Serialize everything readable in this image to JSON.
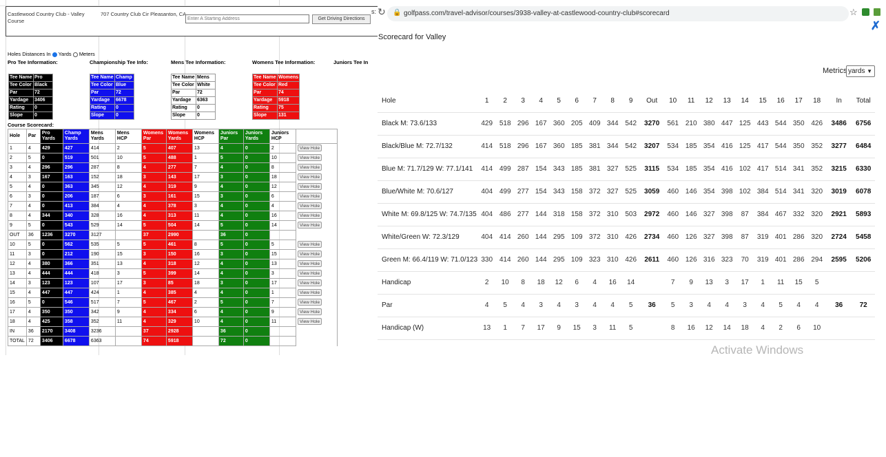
{
  "left": {
    "course_name": "Castlewood Country Club - Valley Course",
    "course_address": "707 Country Club Cir Pleasanton, CA",
    "address_placeholder": "Enter A Starting Address",
    "directions_button": "Get Driving Directions",
    "distance_units_prefix": "Holes Distances In",
    "unit_yards": "Yards",
    "unit_meters": "Meters",
    "selected_unit": "Yards",
    "section_pro": "Pro Tee Information:",
    "section_champ": "Championship Tee Info:",
    "section_mens": "Mens Tee Information:",
    "section_womens": "Womens Tee Information:",
    "section_juniors": "Juniors Tee In",
    "scorecard_label": "Course Scorecard:",
    "tee_tables": [
      {
        "rows": [
          [
            "Tee Name",
            "Pro"
          ],
          [
            "Tee Color",
            "Black"
          ],
          [
            "Par",
            "72"
          ],
          [
            "Yardage",
            "3406"
          ],
          [
            "Rating",
            "0"
          ],
          [
            "Slope",
            "0"
          ]
        ],
        "theme": "black"
      },
      {
        "rows": [
          [
            "Tee Name",
            "Champ"
          ],
          [
            "Tee Color",
            "Blue"
          ],
          [
            "Par",
            "72"
          ],
          [
            "Yardage",
            "6678"
          ],
          [
            "Rating",
            "0"
          ],
          [
            "Slope",
            "0"
          ]
        ],
        "theme": "blue"
      },
      {
        "rows": [
          [
            "Tee Name",
            "Mens"
          ],
          [
            "Tee Color",
            "White"
          ],
          [
            "Par",
            "72"
          ],
          [
            "Yardage",
            "6363"
          ],
          [
            "Rating",
            "0"
          ],
          [
            "Slope",
            "0"
          ]
        ],
        "theme": "white"
      },
      {
        "rows": [
          [
            "Tee Name",
            "Womens"
          ],
          [
            "Tee Color",
            "Red"
          ],
          [
            "Par",
            "74"
          ],
          [
            "Yardage",
            "5918"
          ],
          [
            "Rating",
            "75"
          ],
          [
            "Slope",
            "131"
          ]
        ],
        "theme": "red"
      }
    ],
    "scorecard_headers": [
      "Hole",
      "Par",
      "Pro Yards",
      "Champ Yards",
      "Mens Yards",
      "Mens HCP",
      "Womens Par",
      "Womens Yards",
      "Womens HCP",
      "Juniors Par",
      "Juniors Yards",
      "Juniors HCP",
      ""
    ],
    "view_hole_label": "View Hole",
    "scorecard_rows": [
      [
        "1",
        "4",
        "429",
        "427",
        "414",
        "2",
        "5",
        "407",
        "13",
        "4",
        "0",
        "2"
      ],
      [
        "2",
        "5",
        "0",
        "519",
        "501",
        "10",
        "5",
        "488",
        "1",
        "5",
        "0",
        "10"
      ],
      [
        "3",
        "4",
        "296",
        "296",
        "287",
        "8",
        "4",
        "277",
        "7",
        "4",
        "0",
        "8"
      ],
      [
        "4",
        "3",
        "167",
        "163",
        "152",
        "18",
        "3",
        "143",
        "17",
        "3",
        "0",
        "18"
      ],
      [
        "5",
        "4",
        "0",
        "363",
        "345",
        "12",
        "4",
        "319",
        "9",
        "4",
        "0",
        "12"
      ],
      [
        "6",
        "3",
        "0",
        "206",
        "187",
        "6",
        "3",
        "161",
        "15",
        "3",
        "0",
        "6"
      ],
      [
        "7",
        "4",
        "0",
        "413",
        "384",
        "4",
        "4",
        "378",
        "3",
        "4",
        "0",
        "4"
      ],
      [
        "8",
        "4",
        "344",
        "340",
        "328",
        "16",
        "4",
        "313",
        "11",
        "4",
        "0",
        "16"
      ],
      [
        "9",
        "5",
        "0",
        "543",
        "529",
        "14",
        "5",
        "504",
        "14",
        "5",
        "0",
        "14"
      ],
      [
        "OUT",
        "36",
        "1236",
        "3270",
        "3127",
        "",
        "37",
        "2990",
        "",
        "36",
        "0",
        ""
      ],
      [
        "10",
        "5",
        "0",
        "562",
        "535",
        "5",
        "5",
        "461",
        "8",
        "5",
        "0",
        "5"
      ],
      [
        "11",
        "3",
        "0",
        "212",
        "190",
        "15",
        "3",
        "150",
        "16",
        "3",
        "0",
        "15"
      ],
      [
        "12",
        "4",
        "380",
        "366",
        "351",
        "13",
        "4",
        "318",
        "12",
        "4",
        "0",
        "13"
      ],
      [
        "13",
        "4",
        "444",
        "444",
        "418",
        "3",
        "5",
        "399",
        "14",
        "4",
        "0",
        "3"
      ],
      [
        "14",
        "3",
        "123",
        "123",
        "107",
        "17",
        "3",
        "85",
        "18",
        "3",
        "0",
        "17"
      ],
      [
        "15",
        "4",
        "447",
        "447",
        "424",
        "1",
        "4",
        "385",
        "4",
        "4",
        "0",
        "1"
      ],
      [
        "16",
        "5",
        "0",
        "546",
        "517",
        "7",
        "5",
        "467",
        "2",
        "5",
        "0",
        "7"
      ],
      [
        "17",
        "4",
        "350",
        "350",
        "342",
        "9",
        "4",
        "334",
        "6",
        "4",
        "0",
        "9"
      ],
      [
        "18",
        "4",
        "425",
        "358",
        "352",
        "11",
        "4",
        "329",
        "10",
        "4",
        "0",
        "11"
      ],
      [
        "IN",
        "36",
        "2170",
        "3408",
        "3236",
        "",
        "37",
        "2928",
        "",
        "36",
        "0",
        ""
      ],
      [
        "TOTAL",
        "72",
        "3406",
        "6678",
        "6363",
        "",
        "74",
        "5918",
        "",
        "72",
        "0",
        ""
      ]
    ]
  },
  "browser": {
    "url": "golfpass.com/travel-advisor/courses/3938-valley-at-castlewood-country-club#scorecard",
    "left_fragment": "s:",
    "icons": [
      "reload-icon",
      "lock-icon",
      "star-icon",
      "extension-icon",
      "puzzle-icon"
    ]
  },
  "scorecard": {
    "title": "Scorecard for Valley",
    "metrics_label": "Metrics:",
    "metrics_value": "yards",
    "header": [
      "Hole",
      "1",
      "2",
      "3",
      "4",
      "5",
      "6",
      "7",
      "8",
      "9",
      "Out",
      "10",
      "11",
      "12",
      "13",
      "14",
      "15",
      "16",
      "17",
      "18",
      "In",
      "Total"
    ],
    "rows": [
      [
        "Black M: 73.6/133",
        "429",
        "518",
        "296",
        "167",
        "360",
        "205",
        "409",
        "344",
        "542",
        "3270",
        "561",
        "210",
        "380",
        "447",
        "125",
        "443",
        "544",
        "350",
        "426",
        "3486",
        "6756"
      ],
      [
        "Black/Blue M: 72.7/132",
        "414",
        "518",
        "296",
        "167",
        "360",
        "185",
        "381",
        "344",
        "542",
        "3207",
        "534",
        "185",
        "354",
        "416",
        "125",
        "417",
        "544",
        "350",
        "352",
        "3277",
        "6484"
      ],
      [
        "Blue M: 71.7/129 W: 77.1/141",
        "414",
        "499",
        "287",
        "154",
        "343",
        "185",
        "381",
        "327",
        "525",
        "3115",
        "534",
        "185",
        "354",
        "416",
        "102",
        "417",
        "514",
        "341",
        "352",
        "3215",
        "6330"
      ],
      [
        "Blue/White M: 70.6/127",
        "404",
        "499",
        "277",
        "154",
        "343",
        "158",
        "372",
        "327",
        "525",
        "3059",
        "460",
        "146",
        "354",
        "398",
        "102",
        "384",
        "514",
        "341",
        "320",
        "3019",
        "6078"
      ],
      [
        "White M: 69.8/125 W: 74.7/135",
        "404",
        "486",
        "277",
        "144",
        "318",
        "158",
        "372",
        "310",
        "503",
        "2972",
        "460",
        "146",
        "327",
        "398",
        "87",
        "384",
        "467",
        "332",
        "320",
        "2921",
        "5893"
      ],
      [
        "White/Green W: 72.3/129",
        "404",
        "414",
        "260",
        "144",
        "295",
        "109",
        "372",
        "310",
        "426",
        "2734",
        "460",
        "126",
        "327",
        "398",
        "87",
        "319",
        "401",
        "286",
        "320",
        "2724",
        "5458"
      ],
      [
        "Green M: 66.4/119 W: 71.0/123",
        "330",
        "414",
        "260",
        "144",
        "295",
        "109",
        "323",
        "310",
        "426",
        "2611",
        "460",
        "126",
        "316",
        "323",
        "70",
        "319",
        "401",
        "286",
        "294",
        "2595",
        "5206"
      ],
      [
        "Handicap",
        "2",
        "10",
        "8",
        "18",
        "12",
        "6",
        "4",
        "16",
        "14",
        "",
        "7",
        "9",
        "13",
        "3",
        "17",
        "1",
        "11",
        "15",
        "5",
        "",
        ""
      ],
      [
        "Par",
        "4",
        "5",
        "4",
        "3",
        "4",
        "3",
        "4",
        "4",
        "5",
        "36",
        "5",
        "3",
        "4",
        "4",
        "3",
        "4",
        "5",
        "4",
        "4",
        "36",
        "72"
      ],
      [
        "Handicap (W)",
        "13",
        "1",
        "7",
        "17",
        "9",
        "15",
        "3",
        "11",
        "5",
        "",
        "8",
        "16",
        "12",
        "14",
        "18",
        "4",
        "2",
        "6",
        "10",
        "",
        ""
      ]
    ]
  },
  "watermark": "Activate Windows"
}
